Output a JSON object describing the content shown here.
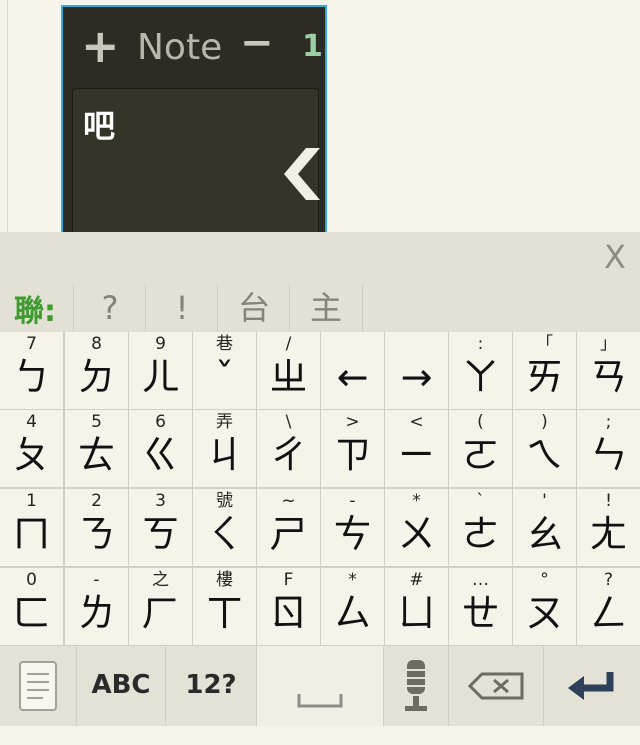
{
  "note": {
    "title": "Note",
    "plus": "+",
    "minus": "−",
    "number": "1",
    "content": "吧"
  },
  "suggestion": {
    "label": "聯:",
    "candidates": [
      "?",
      "!",
      "台",
      "主"
    ],
    "close": "X"
  },
  "rows": [
    [
      {
        "s": "7",
        "p": "ㄅ"
      },
      {
        "s": "8",
        "p": "ㄉ"
      },
      {
        "s": "9",
        "p": "ㄦ"
      },
      {
        "s": "巷",
        "p": "ˇ"
      },
      {
        "s": "/",
        "p": "ㄓ"
      },
      {
        "s": "",
        "p": "←"
      },
      {
        "s": "",
        "p": "→"
      },
      {
        "s": ":",
        "p": "ㄚ"
      },
      {
        "s": "「",
        "p": "ㄞ"
      },
      {
        "s": "」",
        "p": "ㄢ"
      }
    ],
    [
      {
        "s": "4",
        "p": "ㄆ"
      },
      {
        "s": "5",
        "p": "ㄊ"
      },
      {
        "s": "6",
        "p": "ㄍ"
      },
      {
        "s": "弄",
        "p": "ㄐ"
      },
      {
        "s": "\\",
        "p": "ㄔ"
      },
      {
        "s": ">",
        "p": "ㄗ"
      },
      {
        "s": "<",
        "p": "ㄧ"
      },
      {
        "s": "(",
        "p": "ㄛ"
      },
      {
        "s": ")",
        "p": "ㄟ"
      },
      {
        "s": ";",
        "p": "ㄣ"
      }
    ],
    [
      {
        "s": "1",
        "p": "ㄇ"
      },
      {
        "s": "2",
        "p": "ㄋ"
      },
      {
        "s": "3",
        "p": "ㄎ"
      },
      {
        "s": "號",
        "p": "ㄑ"
      },
      {
        "s": "~",
        "p": "ㄕ"
      },
      {
        "s": "-",
        "p": "ㄘ"
      },
      {
        "s": "*",
        "p": "ㄨ"
      },
      {
        "s": "`",
        "p": "ㄜ"
      },
      {
        "s": "'",
        "p": "ㄠ"
      },
      {
        "s": "!",
        "p": "ㄤ"
      }
    ],
    [
      {
        "s": "0",
        "p": "ㄈ"
      },
      {
        "s": "-",
        "p": "ㄌ"
      },
      {
        "s": "之",
        "p": "ㄏ"
      },
      {
        "s": "樓",
        "p": "ㄒ"
      },
      {
        "s": "F",
        "p": "ㄖ"
      },
      {
        "s": "*",
        "p": "ㄙ"
      },
      {
        "s": "#",
        "p": "ㄩ"
      },
      {
        "s": "…",
        "p": "ㄝ"
      },
      {
        "s": "°",
        "p": "ㄡ"
      },
      {
        "s": "?",
        "p": "ㄥ"
      }
    ]
  ],
  "bottom": {
    "abc": "ABC",
    "num": "12?"
  }
}
